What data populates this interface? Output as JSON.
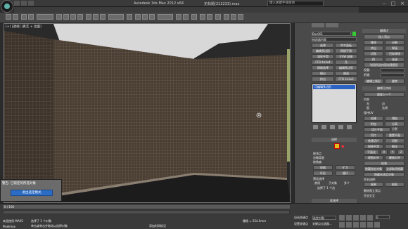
{
  "app": {
    "title": "Autodesk 3ds Max 2012 x64",
    "file": "无标题(212233).max",
    "search_placeholder": "键入关键字或短语"
  },
  "viewport": {
    "label": "[+] [透视] [真实 + 边面]"
  },
  "panel": {
    "object_name": "Box001",
    "modifier_list": "修改器列表",
    "mod_buttons": [
      "选择",
      "命令面板",
      "编辑多边形",
      "网格平滑",
      "涡轮平滑",
      "UVW 贴图",
      "FFD 4x4x4",
      "壳",
      "网格选择",
      "编辑多边形",
      "细分",
      "曲面",
      "挤出",
      "FFD 2x2x2"
    ],
    "stack_item": "可编辑多边形",
    "selection_title": "选择",
    "selection_checks": [
      "按顶点",
      "忽略背面",
      "按角度:"
    ],
    "selection_buttons": [
      "收缩",
      "扩大",
      "环形",
      "循环"
    ],
    "subobj_title": "预览选择",
    "subobj_options": [
      "禁用",
      "子对象",
      "多个"
    ],
    "status_sel": "选择了 1 个边",
    "soft_sel": "软选择",
    "edit_title": "编辑边",
    "edit_buttons": [
      "插入顶点",
      "移除",
      "分割",
      "挤出",
      "焊接",
      "切角",
      "目标焊接",
      "桥",
      "连接",
      "利用所选内容创建图形",
      "权重:",
      "折缝:",
      "编辑三角形",
      "旋转"
    ],
    "edit_geo_title": "编辑几何体",
    "edit_geo_buttons": [
      "重复上一个",
      "约束",
      "无",
      "边",
      "面",
      "法线",
      "保持UV",
      "创建",
      "塌陷",
      "附加",
      "分离",
      "切片平面",
      "分割",
      "切片",
      "重置平面",
      "快速切片",
      "切割",
      "网格平滑",
      "细化",
      "平面化",
      "X",
      "Y",
      "Z",
      "视图对齐",
      "栅格对齐",
      "松弛",
      "隐藏选定对象",
      "全部取消隐藏",
      "隐藏未选定对象",
      "命名选择:",
      "复制",
      "粘贴",
      "删除孤立顶点",
      "完全交互"
    ]
  },
  "popup": {
    "title": "警告: 已锁定的所选对象",
    "button": "退出选定模式"
  },
  "status": {
    "frames": "0 / 100",
    "selection": "选择了 1 个对象",
    "prompt": "单击或单击并拖动以选择对象",
    "welcome": "欢迎使用 MAXS",
    "grid": "栅格 = 254.0mm",
    "autokey": "自动关键点",
    "selected": "选定对象",
    "setkey": "设置关键点",
    "keyfilter": "关键点过滤器...",
    "add_time": "添加时间标记",
    "pixel": "Pixelmax",
    "frame_value": "0"
  }
}
